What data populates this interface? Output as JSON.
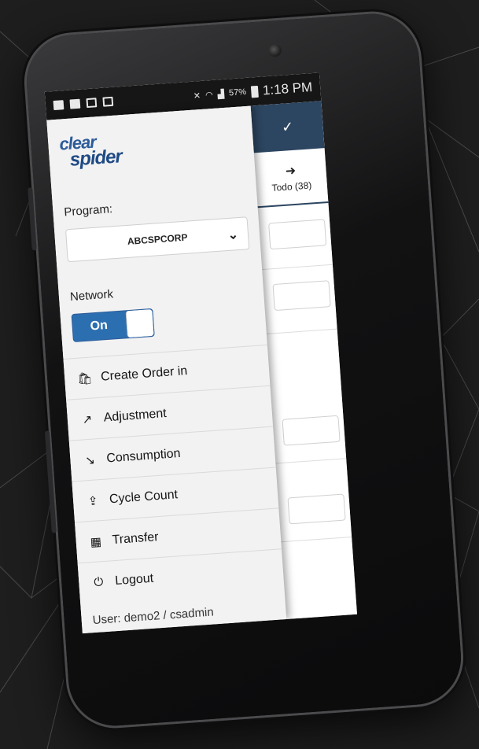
{
  "status_bar": {
    "battery_pct": "57%",
    "time": "1:18 PM"
  },
  "background_app": {
    "check_glyph": "✓",
    "tab_glyph": "➜",
    "tab_label": "Todo (38)"
  },
  "drawer": {
    "logo_top": "clear",
    "logo_bottom": "spider",
    "program_label": "Program:",
    "program_value": "ABCSPCORP",
    "network_label": "Network",
    "network_toggle_label": "On",
    "menu": [
      {
        "label": "Create Order in",
        "icon": "shopping-bag-icon",
        "glyph": "🛍"
      },
      {
        "label": "Adjustment",
        "icon": "arrow-up-right-icon",
        "glyph": "↗"
      },
      {
        "label": "Consumption",
        "icon": "arrow-down-right-icon",
        "glyph": "↘"
      },
      {
        "label": "Cycle Count",
        "icon": "share-out-icon",
        "glyph": "⇪"
      },
      {
        "label": "Transfer",
        "icon": "grid-icon",
        "glyph": "▦"
      },
      {
        "label": "Logout",
        "icon": "power-icon",
        "glyph": "⏻"
      }
    ],
    "user_line": "User: demo2 / csadmin"
  },
  "colors": {
    "accent": "#2c6fb0",
    "header": "#2c4560",
    "background": "#1e1e1f"
  }
}
